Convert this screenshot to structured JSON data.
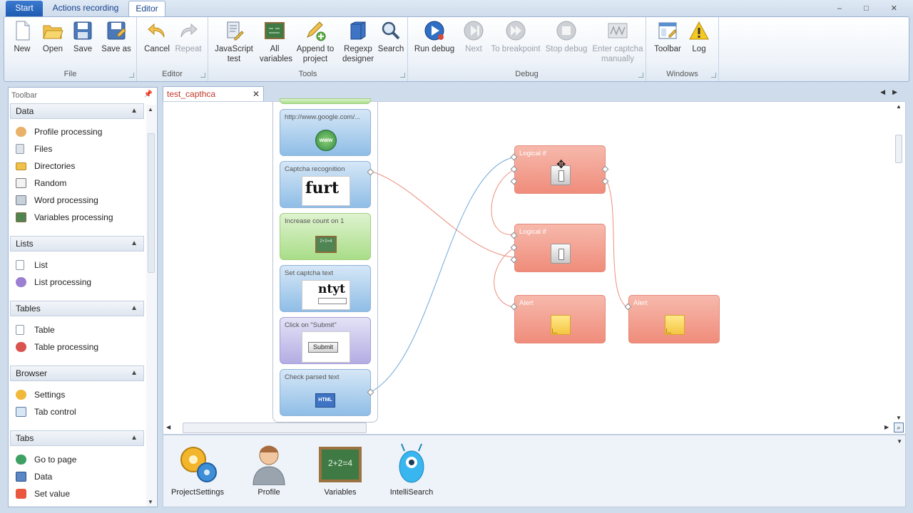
{
  "tabs": {
    "start": "Start",
    "recording": "Actions recording",
    "editor": "Editor"
  },
  "window_controls": "–  □  ✕",
  "ribbon": {
    "file": {
      "caption": "File",
      "new": "New",
      "open": "Open",
      "save": "Save",
      "save_as": "Save as"
    },
    "editor": {
      "caption": "Editor",
      "cancel": "Cancel",
      "repeat": "Repeat"
    },
    "tools": {
      "caption": "Tools",
      "js_test": [
        "JavaScript",
        "test"
      ],
      "all_vars": [
        "All",
        "variables"
      ],
      "append": [
        "Append to",
        "project"
      ],
      "regexp": [
        "Regexp",
        "designer"
      ],
      "search": "Search"
    },
    "debug": {
      "caption": "Debug",
      "run": "Run debug",
      "next": "Next",
      "to_bp": "To breakpoint",
      "stop": "Stop debug",
      "captcha": [
        "Enter captcha",
        "manually"
      ]
    },
    "windows": {
      "caption": "Windows",
      "toolbar": "Toolbar",
      "log": "Log"
    }
  },
  "toolbar_panel": {
    "title": "Toolbar",
    "categories": {
      "data": {
        "label": "Data",
        "items": [
          "Profile processing",
          "Files",
          "Directories",
          "Random",
          "Word processing",
          "Variables processing"
        ]
      },
      "lists": {
        "label": "Lists",
        "items": [
          "List",
          "List processing"
        ]
      },
      "tables": {
        "label": "Tables",
        "items": [
          "Table",
          "Table processing"
        ]
      },
      "browser": {
        "label": "Browser",
        "items": [
          "Settings",
          "Tab control"
        ]
      },
      "tabs": {
        "label": "Tabs",
        "items": [
          "Go to page",
          "Data",
          "Set value"
        ]
      }
    }
  },
  "editor": {
    "tab_title": "test_capthca",
    "nodes": {
      "url": "http://www.google.com/...",
      "url_icon": "www",
      "captcha_recognition": "Captcha recognition",
      "captcha_image_text": "furt",
      "increase_count": "Increase count on 1",
      "chalk_icon_text": "2+2=4",
      "set_captcha": "Set captcha text",
      "set_captcha_image_text": "ntyt",
      "click_submit": "Click on \"Submit\"",
      "submit_label": "Submit",
      "check_parsed": "Check parsed text",
      "html_icon": "HTML",
      "logical_if_1": "Logical if",
      "logical_if_2": "Logical if",
      "alert_1": "Alert",
      "alert_2": "Alert"
    }
  },
  "bottom_panel": {
    "project_settings": "ProjectSettings",
    "profile": "Profile",
    "variables": "Variables",
    "variables_icon_text": "2+2=4",
    "intellisearch": "IntelliSearch"
  },
  "colors": {
    "accent": "#1f5bb0",
    "red_node": "#f08c7b",
    "blue_node": "#8fbde6",
    "green_node": "#a9dd88",
    "purple_node": "#b3ace3"
  }
}
